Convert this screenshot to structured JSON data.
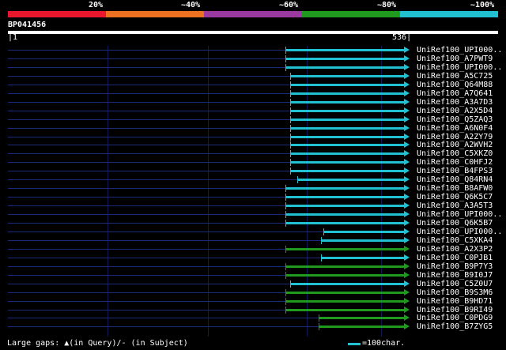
{
  "colors": {
    "legend": [
      "#e8172e",
      "#ec7222",
      "#9a3aa0",
      "#1f9a1f",
      "#22c1d1"
    ],
    "gap": "#1a2a7a",
    "cyan": "#22c1d1",
    "green": "#1f9a1f"
  },
  "legend": {
    "labels": [
      "20%",
      "~40%",
      "~60%",
      "~80%",
      "~100%"
    ]
  },
  "query": {
    "id": "BP041456",
    "start": "1",
    "end": "536"
  },
  "hits": [
    {
      "label": "UniRef100_UPI000..",
      "color": "cyan",
      "start": 361
    },
    {
      "label": "UniRef100_A7PWT9",
      "color": "cyan",
      "start": 361
    },
    {
      "label": "UniRef100_UPI000..",
      "color": "cyan",
      "start": 361
    },
    {
      "label": "UniRef100_A5C725",
      "color": "cyan",
      "start": 367
    },
    {
      "label": "UniRef100_Q64M88",
      "color": "cyan",
      "start": 367
    },
    {
      "label": "UniRef100_A7Q641",
      "color": "cyan",
      "start": 367
    },
    {
      "label": "UniRef100_A3A7D3",
      "color": "cyan",
      "start": 367
    },
    {
      "label": "UniRef100_A2X5D4",
      "color": "cyan",
      "start": 367
    },
    {
      "label": "UniRef100_Q5ZAQ3",
      "color": "cyan",
      "start": 367
    },
    {
      "label": "UniRef100_A6N0F4",
      "color": "cyan",
      "start": 367
    },
    {
      "label": "UniRef100_A2ZY79",
      "color": "cyan",
      "start": 367
    },
    {
      "label": "UniRef100_A2WVH2",
      "color": "cyan",
      "start": 367
    },
    {
      "label": "UniRef100_C5XKZ0",
      "color": "cyan",
      "start": 367
    },
    {
      "label": "UniRef100_C0HFJ2",
      "color": "cyan",
      "start": 367
    },
    {
      "label": "UniRef100_B4FPS3",
      "color": "cyan",
      "start": 367
    },
    {
      "label": "UniRef100_Q84RN4",
      "color": "cyan",
      "start": 376
    },
    {
      "label": "UniRef100_B8AFW0",
      "color": "cyan",
      "start": 361
    },
    {
      "label": "UniRef100_Q6K5C7",
      "color": "cyan",
      "start": 361
    },
    {
      "label": "UniRef100_A3A5T3",
      "color": "cyan",
      "start": 361
    },
    {
      "label": "UniRef100_UPI000..",
      "color": "cyan",
      "start": 361
    },
    {
      "label": "UniRef100_Q6K5B7",
      "color": "cyan",
      "start": 361
    },
    {
      "label": "UniRef100_UPI000..",
      "color": "cyan",
      "start": 409
    },
    {
      "label": "UniRef100_C5XKA4",
      "color": "cyan",
      "start": 406
    },
    {
      "label": "UniRef100_A2X3P2",
      "color": "green",
      "start": 361
    },
    {
      "label": "UniRef100_C0PJB1",
      "color": "cyan",
      "start": 406
    },
    {
      "label": "UniRef100_B9P7Y3",
      "color": "green",
      "start": 361
    },
    {
      "label": "UniRef100_B9I0J7",
      "color": "green",
      "start": 361
    },
    {
      "label": "UniRef100_C5Z0U7",
      "color": "cyan",
      "start": 367
    },
    {
      "label": "UniRef100_B9S3M6",
      "color": "green",
      "start": 361
    },
    {
      "label": "UniRef100_B9HD71",
      "color": "green",
      "start": 361
    },
    {
      "label": "UniRef100_B9RI49",
      "color": "green",
      "start": 361
    },
    {
      "label": "UniRef100_C0PDG9",
      "color": "green",
      "start": 403
    },
    {
      "label": "UniRef100_B7ZYG5",
      "color": "green",
      "start": 403
    }
  ],
  "footer": {
    "gaps_text": "Large gaps: ▲(in Query)/- (in Subject)",
    "scale_text": "=100char."
  }
}
